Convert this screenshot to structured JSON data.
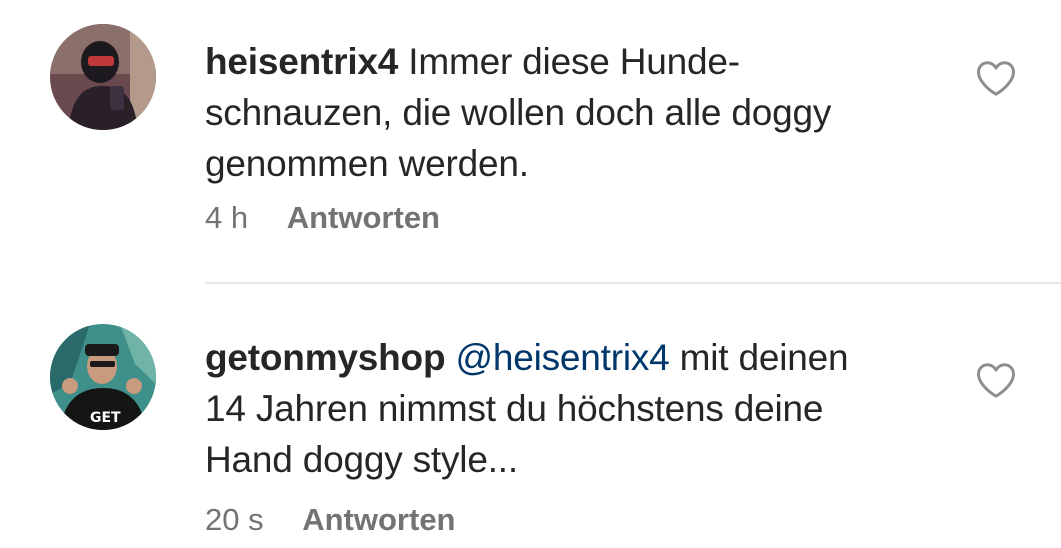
{
  "comments": [
    {
      "username": "heisentrix4",
      "mention": "",
      "line1": "Immer diese Hunde-",
      "line2": "schnauzen, die wollen doch alle doggy",
      "line3": "genommen werden.",
      "time": "4 h",
      "reply_label": "Antworten",
      "like_icon": "heart-outline-icon"
    },
    {
      "username": "getonmyshop",
      "mention": "@heisentrix4",
      "line1": "mit deinen",
      "line2": "14 Jahren nimmst du höchstens deine",
      "line3": "Hand doggy style...",
      "time": "20 s",
      "reply_label": "Antworten",
      "like_icon": "heart-outline-icon"
    }
  ],
  "colors": {
    "text": "#262626",
    "mention": "#00376b",
    "meta": "#737373",
    "divider": "#e6e6e6"
  }
}
